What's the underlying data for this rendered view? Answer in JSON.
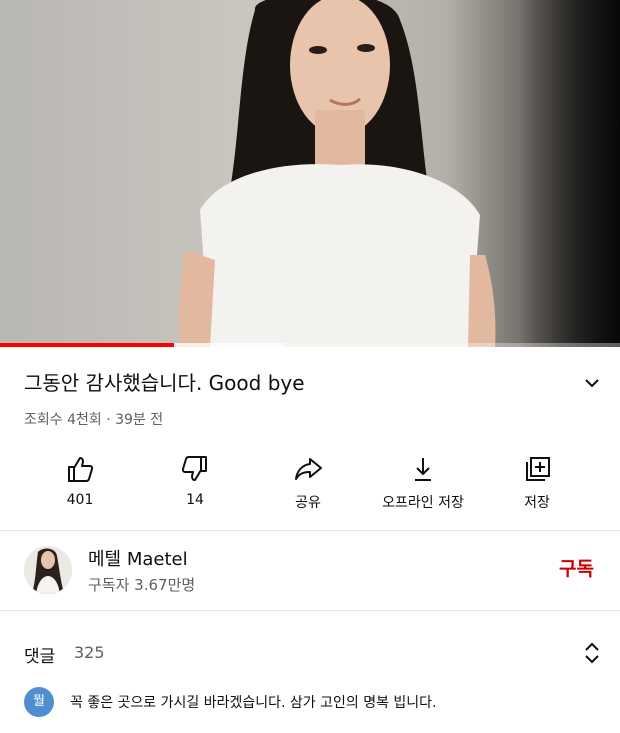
{
  "video": {
    "progress_percent": 28,
    "buffer_percent": 46
  },
  "title": "그동안 감사했습니다. Good bye",
  "meta": "조회수 4천회 · 39분 전",
  "actions": [
    {
      "icon": "thumbs-up-icon",
      "label": "401"
    },
    {
      "icon": "thumbs-down-icon",
      "label": "14"
    },
    {
      "icon": "share-icon",
      "label": "공유"
    },
    {
      "icon": "download-icon",
      "label": "오프라인 저장"
    },
    {
      "icon": "save-playlist-icon",
      "label": "저장"
    }
  ],
  "channel": {
    "name": "메텔 Maetel",
    "subscribers": "구독자 3.67만명",
    "subscribe_label": "구독"
  },
  "comments": {
    "heading": "댓글",
    "count": "325",
    "preview_avatar_letter": "뭘",
    "preview_text": "꼭 좋은 곳으로 가시길 바라겠습니다. 삼가 고인의 명복 빕니다."
  },
  "colors": {
    "accent": "#cc0000",
    "progress": "#ff0000",
    "secondary_text": "#606060"
  }
}
